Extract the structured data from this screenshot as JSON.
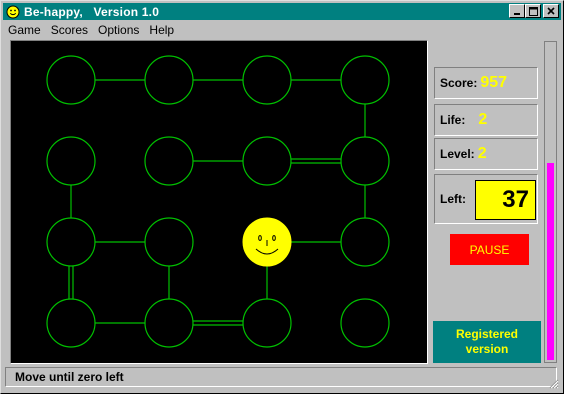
{
  "window": {
    "title": "Be-happy,   Version 1.0",
    "app_icon": "smiley-icon"
  },
  "menu": [
    "Game",
    "Scores",
    "Options",
    "Help"
  ],
  "stats": {
    "score_label": "Score:",
    "score": "957",
    "life_label": "Life:",
    "life": "2",
    "level_label": "Level:",
    "level": "2",
    "left_label": "Left:",
    "left": "37"
  },
  "pause_label": "PAUSE",
  "registered": {
    "line1": "Registered",
    "line2": "version"
  },
  "status": "Move until zero left",
  "progress_fraction": 0.62,
  "colors": {
    "circle": "#00c000",
    "line": "#00c000",
    "player": "#ffff00",
    "accent": "#ff00ff"
  },
  "board": {
    "rows": 4,
    "cols": 4,
    "player": {
      "row": 2,
      "col": 2
    },
    "links": [
      {
        "a": [
          0,
          0
        ],
        "b": [
          0,
          1
        ],
        "type": "single"
      },
      {
        "a": [
          0,
          1
        ],
        "b": [
          0,
          2
        ],
        "type": "single"
      },
      {
        "a": [
          0,
          2
        ],
        "b": [
          0,
          3
        ],
        "type": "single"
      },
      {
        "a": [
          0,
          3
        ],
        "b": [
          1,
          3
        ],
        "type": "single"
      },
      {
        "a": [
          1,
          1
        ],
        "b": [
          1,
          2
        ],
        "type": "single"
      },
      {
        "a": [
          1,
          2
        ],
        "b": [
          1,
          3
        ],
        "type": "double"
      },
      {
        "a": [
          1,
          0
        ],
        "b": [
          2,
          0
        ],
        "type": "single"
      },
      {
        "a": [
          1,
          3
        ],
        "b": [
          2,
          3
        ],
        "type": "single"
      },
      {
        "a": [
          2,
          0
        ],
        "b": [
          2,
          1
        ],
        "type": "single"
      },
      {
        "a": [
          2,
          2
        ],
        "b": [
          2,
          3
        ],
        "type": "single"
      },
      {
        "a": [
          2,
          0
        ],
        "b": [
          3,
          0
        ],
        "type": "double"
      },
      {
        "a": [
          2,
          1
        ],
        "b": [
          3,
          1
        ],
        "type": "single"
      },
      {
        "a": [
          2,
          2
        ],
        "b": [
          3,
          2
        ],
        "type": "single"
      },
      {
        "a": [
          3,
          0
        ],
        "b": [
          3,
          1
        ],
        "type": "single"
      },
      {
        "a": [
          3,
          1
        ],
        "b": [
          3,
          2
        ],
        "type": "double"
      }
    ]
  }
}
